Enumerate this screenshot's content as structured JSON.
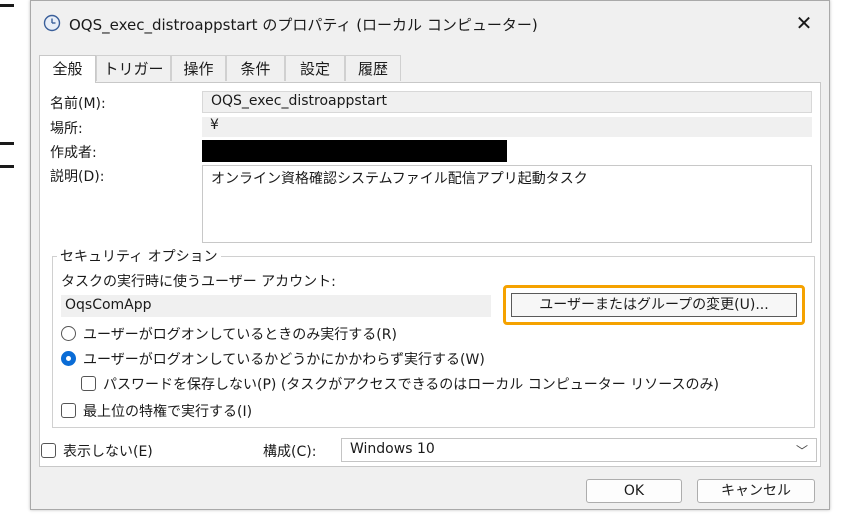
{
  "window": {
    "title": "OQS_exec_distroappstart のプロパティ (ローカル コンピューター)",
    "close_symbol": "✕"
  },
  "tabs": [
    {
      "label": "全般",
      "active": true
    },
    {
      "label": "トリガー",
      "active": false
    },
    {
      "label": "操作",
      "active": false
    },
    {
      "label": "条件",
      "active": false
    },
    {
      "label": "設定",
      "active": false
    },
    {
      "label": "履歴",
      "active": false
    }
  ],
  "general": {
    "name_label": "名前(M):",
    "name_value": "OQS_exec_distroappstart",
    "location_label": "場所:",
    "location_value": "¥",
    "author_label": "作成者:",
    "author_value_redacted": true,
    "description_label": "説明(D):",
    "description_value": "オンライン資格確認システムファイル配信アプリ起動タスク"
  },
  "security": {
    "group_label": "セキュリティ オプション",
    "account_prompt": "タスクの実行時に使うユーザー アカウント:",
    "account_value": "OqsComApp",
    "change_button": "ユーザーまたはグループの変更(U)...",
    "highlight_color": "#f5a200",
    "radio_logged_on_only": "ユーザーがログオンしているときのみ実行する(R)",
    "radio_whether_logged_on": "ユーザーがログオンしているかどうかにかかわらず実行する(W)",
    "radio_selected": "whether_logged_on",
    "check_no_password": "パスワードを保存しない(P) (タスクがアクセスできるのはローカル コンピューター リソースのみ)",
    "check_no_password_checked": false,
    "check_highest_privileges": "最上位の特権で実行する(I)",
    "check_highest_privileges_checked": false
  },
  "footer": {
    "hidden_label": "表示しない(E)",
    "hidden_checked": false,
    "config_label": "構成(C):",
    "config_value": "Windows 10",
    "ok_button": "OK",
    "cancel_button": "キャンセル"
  },
  "colors": {
    "accent": "#0a6cd6",
    "window_bg": "#f0f0f0"
  },
  "icons": {
    "title_icon": "clock-icon",
    "dropdown": "chevron-down-icon"
  }
}
